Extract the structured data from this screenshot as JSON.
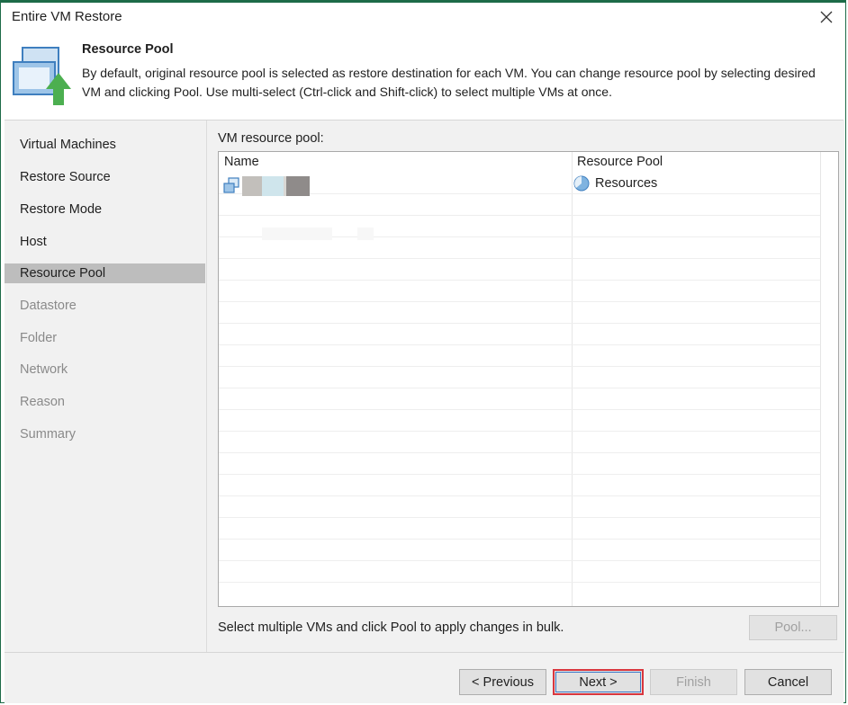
{
  "window": {
    "title": "Entire VM Restore"
  },
  "header": {
    "title": "Resource Pool",
    "description": "By default, original resource pool is selected as restore destination for each VM. You can change resource pool by selecting desired VM and clicking Pool. Use multi-select (Ctrl-click and Shift-click) to select multiple VMs at once."
  },
  "nav": {
    "items": [
      {
        "label": "Virtual Machines",
        "state": "enabled"
      },
      {
        "label": "Restore Source",
        "state": "enabled"
      },
      {
        "label": "Restore Mode",
        "state": "enabled"
      },
      {
        "label": "Host",
        "state": "enabled"
      },
      {
        "label": "Resource Pool",
        "state": "active"
      },
      {
        "label": "Datastore",
        "state": "disabled"
      },
      {
        "label": "Folder",
        "state": "disabled"
      },
      {
        "label": "Network",
        "state": "disabled"
      },
      {
        "label": "Reason",
        "state": "disabled"
      },
      {
        "label": "Summary",
        "state": "disabled"
      }
    ]
  },
  "main": {
    "pool_label": "VM resource pool:",
    "columns": {
      "name": "Name",
      "pool": "Resource Pool"
    },
    "rows": [
      {
        "name": "",
        "pool": "Resources"
      }
    ],
    "hint": "Select multiple VMs and click Pool to apply changes in bulk.",
    "pool_button": "Pool..."
  },
  "footer": {
    "previous": "< Previous",
    "next": "Next >",
    "finish": "Finish",
    "cancel": "Cancel"
  },
  "colors": {
    "accent": "#1d6b48",
    "highlight_border": "#d9363e",
    "active_nav": "#bdbdbd"
  }
}
